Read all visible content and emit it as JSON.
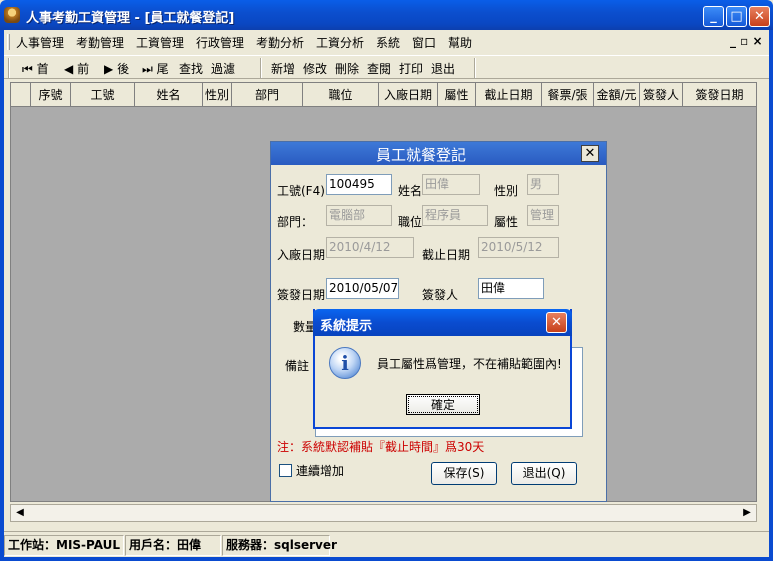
{
  "window": {
    "title": "人事考勤工資管理 - [員工就餐登記]",
    "min": "_",
    "max": "□",
    "close": "✕"
  },
  "menu": {
    "items": [
      "人事管理",
      "考勤管理",
      "工資管理",
      "行政管理",
      "考勤分析",
      "工資分析",
      "系統",
      "窗口",
      "幫助"
    ],
    "mdi_controls": "_ ▫ ×"
  },
  "toolbar": {
    "nav": [
      "首",
      "前",
      "後",
      "尾"
    ],
    "nav_extra": [
      "查找",
      "過濾"
    ],
    "actions": [
      "新增",
      "修改",
      "刪除",
      "查閱",
      "打印",
      "退出"
    ]
  },
  "grid": {
    "columns": [
      "序號",
      "工號",
      "姓名",
      "性別",
      "部門",
      "職位",
      "入廠日期",
      "屬性",
      "截止日期",
      "餐票/張",
      "金額/元",
      "簽發人",
      "簽發日期"
    ]
  },
  "status": {
    "station": "工作站：MIS-PAUL",
    "user": "用戶名：田偉",
    "server": "服務器：sqlserver"
  },
  "dialog": {
    "title": "員工就餐登記",
    "close": "✕",
    "labels": {
      "emp_no": "工號(F4)",
      "name": "姓名",
      "gender": "性別",
      "dept": "部門：",
      "position": "職位",
      "attr": "屬性",
      "join_date": "入廠日期",
      "end_date": "截止日期",
      "issue_date": "簽發日期",
      "issuer": "簽發人",
      "qty": "數量",
      "remark": "備註"
    },
    "values": {
      "emp_no": "100495",
      "name": "田偉",
      "gender": "男",
      "dept": "電腦部",
      "position": "程序員",
      "attr": "管理",
      "join_date": "2010/4/12",
      "end_date": "2010/5/12",
      "issue_date": "2010/05/07",
      "issuer": "田偉"
    },
    "note": "注：系統默認補貼『截止時間』爲30天",
    "continuous_add": "連續增加",
    "save": "保存(S)",
    "exit": "退出(Q)"
  },
  "message_box": {
    "title": "系統提示",
    "close": "✕",
    "icon": "info-icon",
    "text": "員工屬性爲管理，不在補貼範圍內!",
    "ok": "確定"
  }
}
